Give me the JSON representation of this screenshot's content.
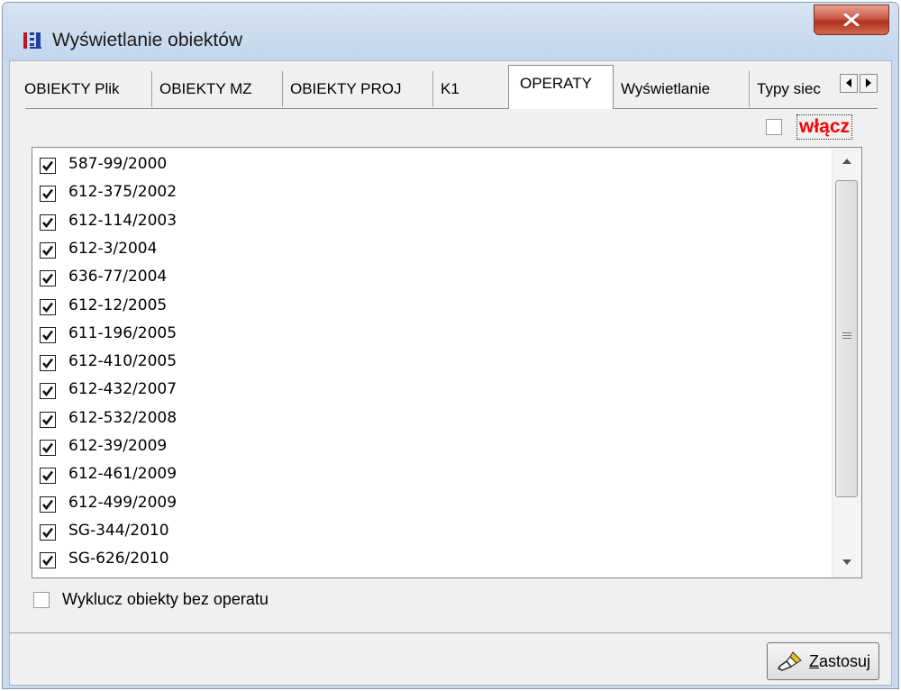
{
  "window": {
    "title": "Wyświetlanie obiektów"
  },
  "tabs": [
    {
      "label": "OBIEKTY Plik"
    },
    {
      "label": "OBIEKTY MZ"
    },
    {
      "label": "OBIEKTY PROJ"
    },
    {
      "label": "K1"
    },
    {
      "label": "OPERATY",
      "active": true
    },
    {
      "label": "Wyświetlanie"
    },
    {
      "label": "Typy siec"
    }
  ],
  "wlacz": {
    "label": "włącz",
    "checked": false
  },
  "operaty": [
    {
      "label": "587-99/2000",
      "checked": true
    },
    {
      "label": "612-375/2002",
      "checked": true
    },
    {
      "label": "612-114/2003",
      "checked": true
    },
    {
      "label": "612-3/2004",
      "checked": true
    },
    {
      "label": "636-77/2004",
      "checked": true
    },
    {
      "label": "612-12/2005",
      "checked": true
    },
    {
      "label": "611-196/2005",
      "checked": true
    },
    {
      "label": "612-410/2005",
      "checked": true
    },
    {
      "label": "612-432/2007",
      "checked": true
    },
    {
      "label": "612-532/2008",
      "checked": true
    },
    {
      "label": "612-39/2009",
      "checked": true
    },
    {
      "label": "612-461/2009",
      "checked": true
    },
    {
      "label": "612-499/2009",
      "checked": true
    },
    {
      "label": "SG-344/2010",
      "checked": true
    },
    {
      "label": "SG-626/2010",
      "checked": true
    }
  ],
  "exclude": {
    "label": "Wyklucz obiekty bez operatu",
    "checked": false
  },
  "apply": {
    "label_first": "Z",
    "label_rest": "astosuj"
  },
  "colors": {
    "accent_red": "#ff0000",
    "close_red": "#c85a47"
  }
}
